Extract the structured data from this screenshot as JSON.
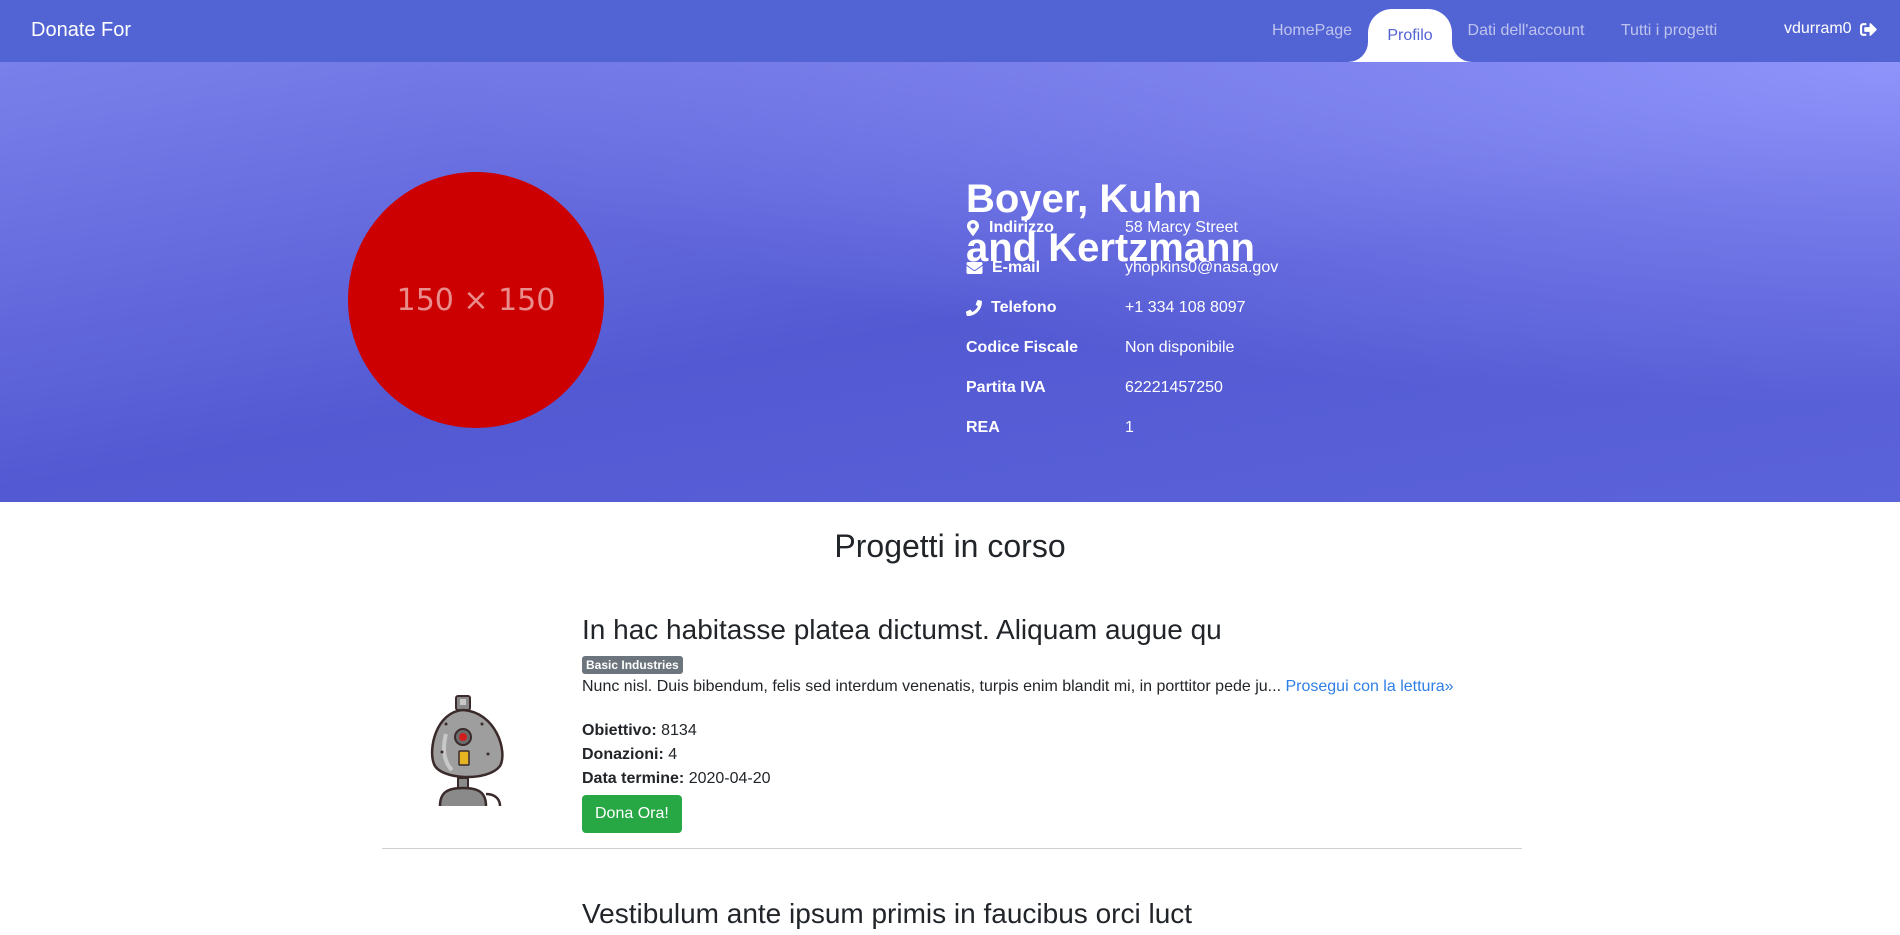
{
  "navbar": {
    "brand": "Donate For",
    "tabs": [
      {
        "label": "HomePage",
        "active": false
      },
      {
        "label": "Profilo",
        "active": true
      },
      {
        "label": "Dati dell'account",
        "active": false
      },
      {
        "label": "Tutti i progetti",
        "active": false
      }
    ],
    "username": "vdurram0",
    "logout_icon": "sign-out-icon"
  },
  "profile": {
    "avatar_text": "150 × 150",
    "avatar_color": "#cc0000",
    "name_line1": "Boyer, Kuhn",
    "name_line2": "and Kertzmann",
    "fields": [
      {
        "icon": "map-marker-icon",
        "label": "Indirizzo",
        "value": "58 Marcy Street"
      },
      {
        "icon": "envelope-icon",
        "label": "E-mail",
        "value": "yhopkins0@nasa.gov"
      },
      {
        "icon": "phone-icon",
        "label": "Telefono",
        "value": "+1 334 108 8097"
      },
      {
        "icon": "",
        "label": "Codice Fiscale",
        "value": "Non disponibile"
      },
      {
        "icon": "",
        "label": "Partita IVA",
        "value": "62221457250"
      },
      {
        "icon": "",
        "label": "REA",
        "value": "1"
      }
    ]
  },
  "projects_section": {
    "title": "Progetti in corso",
    "projects": [
      {
        "title": "In hac habitasse platea dictumst. Aliquam augue qu",
        "category": "Basic Industries",
        "description": "Nunc nisl. Duis bibendum, felis sed interdum venenatis, turpis enim blandit mi, in porttitor pede ju...",
        "read_more": "Prosegui con la lettura»",
        "goal_label": "Obiettivo:",
        "goal": "8134",
        "donations_label": "Donazioni:",
        "donations": "4",
        "deadline_label": "Data termine:",
        "deadline": "2020-04-20",
        "button": "Dona Ora!"
      },
      {
        "title": "Vestibulum ante ipsum primis in faucibus orci luct"
      }
    ]
  },
  "colors": {
    "navbar": "#5263d3",
    "avatar": "#cc0000",
    "donate_button": "#28a745",
    "link": "#2f7fe6",
    "badge": "#6c757d"
  }
}
